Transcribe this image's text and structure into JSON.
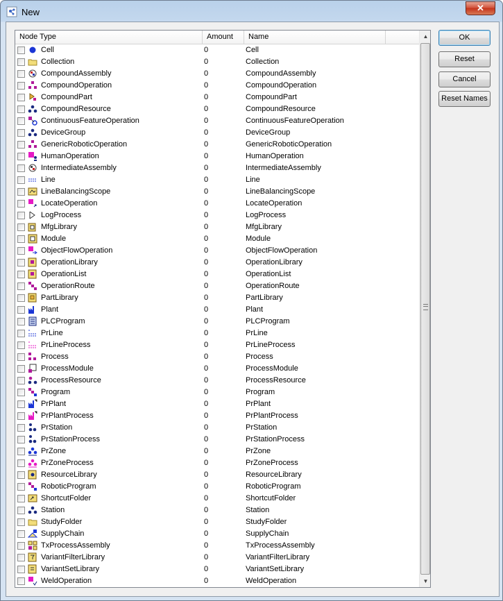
{
  "window": {
    "title": "New",
    "close_label": "✕"
  },
  "columns": [
    "Node Type",
    "Amount",
    "Name"
  ],
  "buttons": {
    "ok": "OK",
    "reset": "Reset",
    "cancel": "Cancel",
    "reset_names": "Reset Names"
  },
  "rows": [
    {
      "type": "Cell",
      "amount": "0",
      "name": "Cell",
      "icon": "cell-icon"
    },
    {
      "type": "Collection",
      "amount": "0",
      "name": "Collection",
      "icon": "collection-icon"
    },
    {
      "type": "CompoundAssembly",
      "amount": "0",
      "name": "CompoundAssembly",
      "icon": "compound-assembly-icon"
    },
    {
      "type": "CompoundOperation",
      "amount": "0",
      "name": "CompoundOperation",
      "icon": "compound-operation-icon"
    },
    {
      "type": "CompoundPart",
      "amount": "0",
      "name": "CompoundPart",
      "icon": "compound-part-icon"
    },
    {
      "type": "CompoundResource",
      "amount": "0",
      "name": "CompoundResource",
      "icon": "compound-resource-icon"
    },
    {
      "type": "ContinuousFeatureOperation",
      "amount": "0",
      "name": "ContinuousFeatureOperation",
      "icon": "continuous-feature-operation-icon"
    },
    {
      "type": "DeviceGroup",
      "amount": "0",
      "name": "DeviceGroup",
      "icon": "device-group-icon"
    },
    {
      "type": "GenericRoboticOperation",
      "amount": "0",
      "name": "GenericRoboticOperation",
      "icon": "generic-robotic-operation-icon"
    },
    {
      "type": "HumanOperation",
      "amount": "0",
      "name": "HumanOperation",
      "icon": "human-operation-icon"
    },
    {
      "type": "IntermediateAssembly",
      "amount": "0",
      "name": "IntermediateAssembly",
      "icon": "intermediate-assembly-icon"
    },
    {
      "type": "Line",
      "amount": "0",
      "name": "Line",
      "icon": "line-icon"
    },
    {
      "type": "LineBalancingScope",
      "amount": "0",
      "name": "LineBalancingScope",
      "icon": "line-balancing-scope-icon"
    },
    {
      "type": "LocateOperation",
      "amount": "0",
      "name": "LocateOperation",
      "icon": "locate-operation-icon"
    },
    {
      "type": "LogProcess",
      "amount": "0",
      "name": "LogProcess",
      "icon": "log-process-icon"
    },
    {
      "type": "MfgLibrary",
      "amount": "0",
      "name": "MfgLibrary",
      "icon": "mfg-library-icon"
    },
    {
      "type": "Module",
      "amount": "0",
      "name": "Module",
      "icon": "module-icon"
    },
    {
      "type": "ObjectFlowOperation",
      "amount": "0",
      "name": "ObjectFlowOperation",
      "icon": "object-flow-operation-icon"
    },
    {
      "type": "OperationLibrary",
      "amount": "0",
      "name": "OperationLibrary",
      "icon": "operation-library-icon"
    },
    {
      "type": "OperationList",
      "amount": "0",
      "name": "OperationList",
      "icon": "operation-list-icon"
    },
    {
      "type": "OperationRoute",
      "amount": "0",
      "name": "OperationRoute",
      "icon": "operation-route-icon"
    },
    {
      "type": "PartLibrary",
      "amount": "0",
      "name": "PartLibrary",
      "icon": "part-library-icon"
    },
    {
      "type": "Plant",
      "amount": "0",
      "name": "Plant",
      "icon": "plant-icon"
    },
    {
      "type": "PLCProgram",
      "amount": "0",
      "name": "PLCProgram",
      "icon": "plc-program-icon"
    },
    {
      "type": "PrLine",
      "amount": "0",
      "name": "PrLine",
      "icon": "pr-line-icon"
    },
    {
      "type": "PrLineProcess",
      "amount": "0",
      "name": "PrLineProcess",
      "icon": "pr-line-process-icon"
    },
    {
      "type": "Process",
      "amount": "0",
      "name": "Process",
      "icon": "process-icon"
    },
    {
      "type": "ProcessModule",
      "amount": "0",
      "name": "ProcessModule",
      "icon": "process-module-icon"
    },
    {
      "type": "ProcessResource",
      "amount": "0",
      "name": "ProcessResource",
      "icon": "process-resource-icon"
    },
    {
      "type": "Program",
      "amount": "0",
      "name": "Program",
      "icon": "program-icon"
    },
    {
      "type": "PrPlant",
      "amount": "0",
      "name": "PrPlant",
      "icon": "pr-plant-icon"
    },
    {
      "type": "PrPlantProcess",
      "amount": "0",
      "name": "PrPlantProcess",
      "icon": "pr-plant-process-icon"
    },
    {
      "type": "PrStation",
      "amount": "0",
      "name": "PrStation",
      "icon": "pr-station-icon"
    },
    {
      "type": "PrStationProcess",
      "amount": "0",
      "name": "PrStationProcess",
      "icon": "pr-station-process-icon"
    },
    {
      "type": "PrZone",
      "amount": "0",
      "name": "PrZone",
      "icon": "pr-zone-icon"
    },
    {
      "type": "PrZoneProcess",
      "amount": "0",
      "name": "PrZoneProcess",
      "icon": "pr-zone-process-icon"
    },
    {
      "type": "ResourceLibrary",
      "amount": "0",
      "name": "ResourceLibrary",
      "icon": "resource-library-icon"
    },
    {
      "type": "RoboticProgram",
      "amount": "0",
      "name": "RoboticProgram",
      "icon": "robotic-program-icon"
    },
    {
      "type": "ShortcutFolder",
      "amount": "0",
      "name": "ShortcutFolder",
      "icon": "shortcut-folder-icon"
    },
    {
      "type": "Station",
      "amount": "0",
      "name": "Station",
      "icon": "station-icon"
    },
    {
      "type": "StudyFolder",
      "amount": "0",
      "name": "StudyFolder",
      "icon": "study-folder-icon"
    },
    {
      "type": "SupplyChain",
      "amount": "0",
      "name": "SupplyChain",
      "icon": "supply-chain-icon"
    },
    {
      "type": "TxProcessAssembly",
      "amount": "0",
      "name": "TxProcessAssembly",
      "icon": "tx-process-assembly-icon"
    },
    {
      "type": "VariantFilterLibrary",
      "amount": "0",
      "name": "VariantFilterLibrary",
      "icon": "variant-filter-library-icon"
    },
    {
      "type": "VariantSetLibrary",
      "amount": "0",
      "name": "VariantSetLibrary",
      "icon": "variant-set-library-icon"
    },
    {
      "type": "WeldOperation",
      "amount": "0",
      "name": "WeldOperation",
      "icon": "weld-operation-icon"
    }
  ]
}
